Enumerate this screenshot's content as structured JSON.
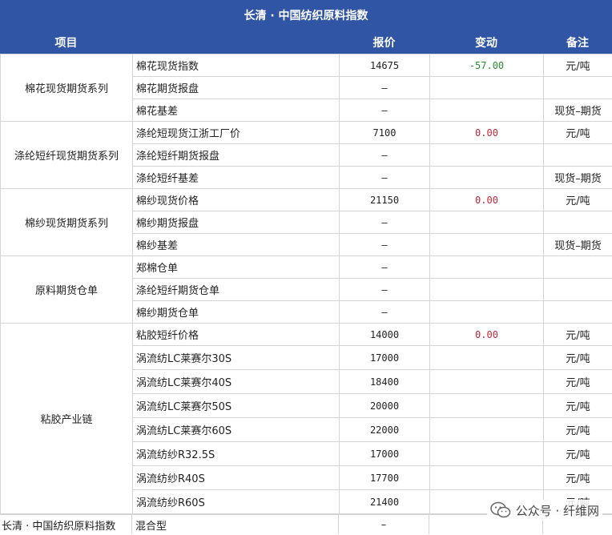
{
  "title": "长清 · 中国纺织原料指数",
  "headers": {
    "item": "项目",
    "price": "报价",
    "change": "变动",
    "note": "备注"
  },
  "groups": [
    {
      "name": "棉花现货期货系列",
      "rows": [
        {
          "item": "棉花现货指数",
          "price": "14675",
          "change": "-57.00",
          "change_type": "neg",
          "note": "元/吨"
        },
        {
          "item": "棉花期货报盘",
          "price": "–",
          "change": "",
          "note": ""
        },
        {
          "item": "棉花基差",
          "price": "–",
          "change": "",
          "note": "现货–期货"
        }
      ]
    },
    {
      "name": "涤纶短纤现货期货系列",
      "rows": [
        {
          "item": "涤纶短现货江浙工厂价",
          "price": "7100",
          "change": "0.00",
          "change_type": "zero",
          "note": "元/吨"
        },
        {
          "item": "涤纶短纤期货报盘",
          "price": "–",
          "change": "",
          "note": ""
        },
        {
          "item": "涤纶短纤基差",
          "price": "–",
          "change": "",
          "note": "现货–期货"
        }
      ]
    },
    {
      "name": "棉纱现货期货系列",
      "rows": [
        {
          "item": "棉纱现货价格",
          "price": "21150",
          "change": "0.00",
          "change_type": "zero",
          "note": "元/吨"
        },
        {
          "item": "棉纱期货报盘",
          "price": "–",
          "change": "",
          "note": ""
        },
        {
          "item": "棉纱基差",
          "price": "–",
          "change": "",
          "note": "现货–期货"
        }
      ]
    },
    {
      "name": "原料期货仓单",
      "rows": [
        {
          "item": "郑棉仓单",
          "price": "–",
          "change": "",
          "note": ""
        },
        {
          "item": "涤纶短纤期货仓单",
          "price": "–",
          "change": "",
          "note": ""
        },
        {
          "item": "棉纱期货仓单",
          "price": "–",
          "change": "",
          "note": ""
        }
      ]
    },
    {
      "name": "粘胶产业链",
      "rows": [
        {
          "item": "粘胶短纤价格",
          "price": "14000",
          "change": "0.00",
          "change_type": "zero",
          "note": "元/吨"
        },
        {
          "item": "涡流纺LC莱赛尔30S",
          "price": "17000",
          "change": "",
          "note": "元/吨"
        },
        {
          "item": "涡流纺LC莱赛尔40S",
          "price": "18400",
          "change": "",
          "note": "元/吨"
        },
        {
          "item": "涡流纺LC莱赛尔50S",
          "price": "20000",
          "change": "",
          "note": "元/吨"
        },
        {
          "item": "涡流纺LC莱赛尔60S",
          "price": "22000",
          "change": "",
          "note": "元/吨"
        },
        {
          "item": "涡流纺纱R32.5S",
          "price": "17000",
          "change": "",
          "note": "元/吨"
        },
        {
          "item": "涡流纺纱R40S",
          "price": "17700",
          "change": "",
          "note": "元/吨"
        },
        {
          "item": "涡流纺纱R60S",
          "price": "21400",
          "change": "",
          "note": "元/吨"
        }
      ]
    }
  ],
  "last_row": {
    "group": "长清 · 中国纺织原料指数",
    "item": "混合型",
    "price": "–"
  },
  "watermark": {
    "text": "公众号 · 纤维网",
    "icon": "wechat-icon"
  },
  "colors": {
    "header_bg": "#2f55a4",
    "neg": "#2e8b3a",
    "zero": "#c0283a"
  }
}
